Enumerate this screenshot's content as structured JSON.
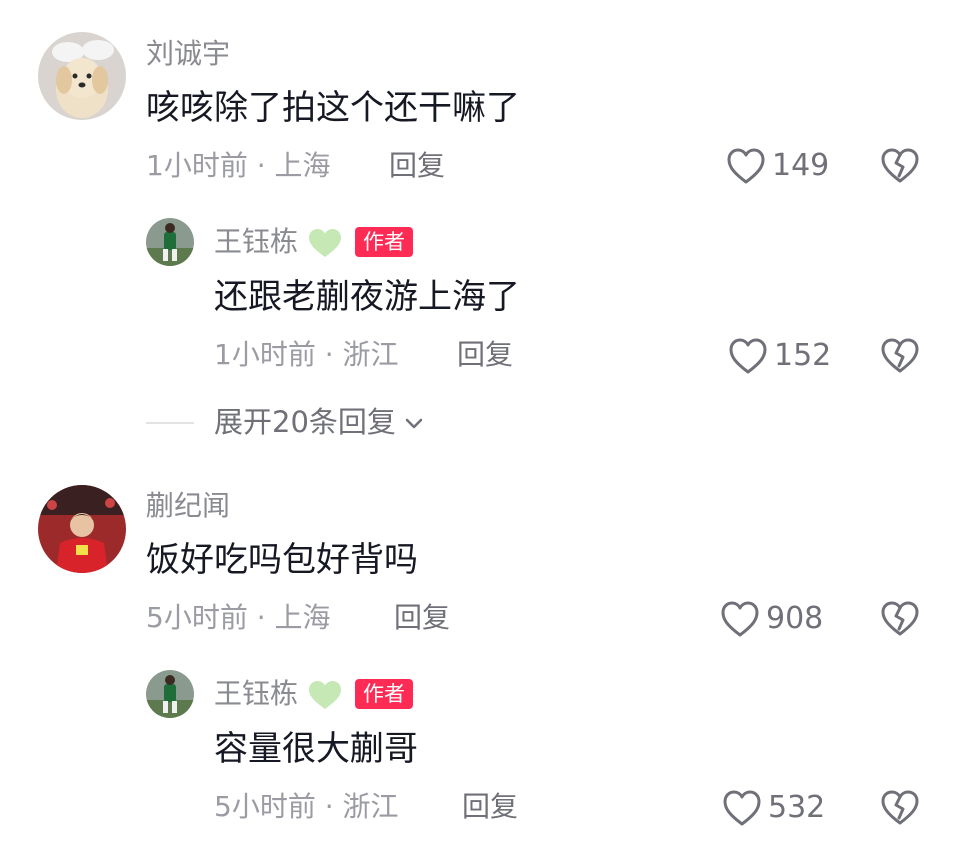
{
  "comments": [
    {
      "username": "刘诚宇",
      "text": "咳咳除了拍这个还干嘛了",
      "time_location": "1小时前 · 上海",
      "reply_label": "回复",
      "likes": "149",
      "avatar": "puppy-with-wings-avatar",
      "replies": [
        {
          "username": "王钰栋",
          "badge": "作者",
          "text": "还跟老蒯夜游上海了",
          "time_location": "1小时前 · 浙江",
          "reply_label": "回复",
          "likes": "152",
          "avatar": "soccer-player-green-avatar"
        }
      ],
      "expand_label": "展开20条回复"
    },
    {
      "username": "蒯纪闻",
      "text": "饭好吃吗包好背吗",
      "time_location": "5小时前 · 上海",
      "reply_label": "回复",
      "likes": "908",
      "avatar": "soccer-player-red-avatar",
      "replies": [
        {
          "username": "王钰栋",
          "badge": "作者",
          "text": "容量很大蒯哥",
          "time_location": "5小时前 · 浙江",
          "reply_label": "回复",
          "likes": "532",
          "avatar": "soccer-player-green-avatar"
        }
      ]
    }
  ],
  "icons": {
    "like": "heart-outline-icon",
    "dislike": "broken-heart-icon",
    "expand": "chevron-down-icon",
    "verified": "green-heart-icon"
  },
  "colors": {
    "badge": "#fe2c55",
    "verified_heart": "#c6e8b4",
    "primary_text": "#161823",
    "secondary_text": "#8a8b91"
  }
}
